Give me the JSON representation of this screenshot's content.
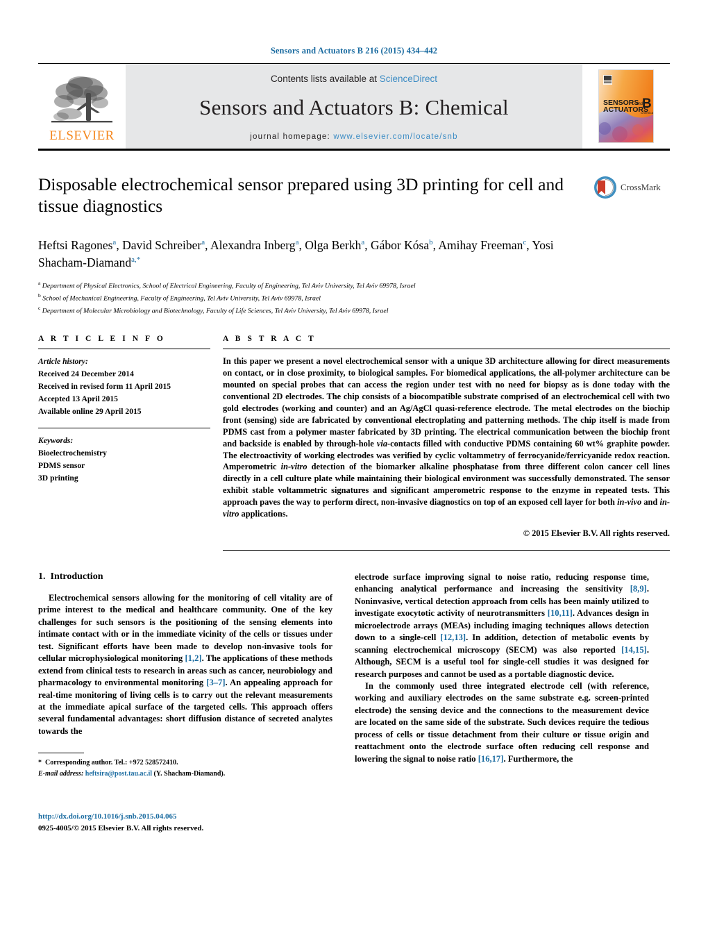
{
  "running_head": "Sensors and Actuators B 216 (2015) 434–442",
  "masthead": {
    "contents_prefix": "Contents lists available at ",
    "sciencedirect": "ScienceDirect",
    "journal_title": "Sensors and Actuators B: Chemical",
    "homepage_prefix": "journal homepage:",
    "homepage_url": "www.elsevier.com/locate/snb",
    "publisher_wordmark": "ELSEVIER",
    "cover": {
      "line1": "SENSORS",
      "and": "and",
      "line2": "ACTUATORS",
      "letter": "B",
      "sub": "Chemical"
    },
    "accent_orange": "#f5881f",
    "accent_blue": "#3c8cc4",
    "panel_gray": "#e6e7e8"
  },
  "title": "Disposable electrochemical sensor prepared using 3D printing for cell and tissue diagnostics",
  "crossmark": {
    "label": "CrossMark"
  },
  "authors_html": "Heftsi Ragones<sup>a</sup>, David Schreiber<sup>a</sup>, Alexandra Inberg<sup>a</sup>, Olga Berkh<sup>a</sup>, Gábor Kósa<sup>b</sup>, Amihay Freeman<sup>c</sup>, Yosi Shacham-Diamand<sup>a,<span class=\"star\">*</span></sup>",
  "affiliations": [
    {
      "mark": "a",
      "text": "Department of Physical Electronics, School of Electrical Engineering, Faculty of Engineering, Tel Aviv University, Tel Aviv 69978, Israel"
    },
    {
      "mark": "b",
      "text": "School of Mechanical Engineering, Faculty of Engineering, Tel Aviv University, Tel Aviv 69978, Israel"
    },
    {
      "mark": "c",
      "text": "Department of Molecular Microbiology and Biotechnology, Faculty of Life Sciences, Tel Aviv University, Tel Aviv 69978, Israel"
    }
  ],
  "article_info": {
    "heading": "A R T I C L E   I N F O",
    "history_label": "Article history:",
    "history": [
      "Received 24 December 2014",
      "Received in revised form 11 April 2015",
      "Accepted 13 April 2015",
      "Available online 29 April 2015"
    ],
    "keywords_label": "Keywords:",
    "keywords": [
      "Bioelectrochemistry",
      "PDMS sensor",
      "3D printing"
    ]
  },
  "abstract": {
    "heading": "A B S T R A C T",
    "body_html": "In this paper we present a novel electrochemical sensor with a unique 3D architecture allowing for direct measurements on contact, or in close proximity, to biological samples. For biomedical applications, the all-polymer architecture can be mounted on special probes that can access the region under test with no need for biopsy as is done today with the conventional 2D electrodes. The chip consists of a biocompatible substrate comprised of an electrochemical cell with two gold electrodes (working and counter) and an Ag/AgCl quasi-reference electrode. The metal electrodes on the biochip front (sensing) side are fabricated by conventional electroplating and patterning methods. The chip itself is made from PDMS cast from a polymer master fabricated by 3D printing. The electrical communication between the biochip front and backside is enabled by through-hole <em>via</em>-contacts filled with conductive PDMS containing 60 wt% graphite powder. The electroactivity of working electrodes was verified by cyclic voltammetry of ferrocyanide/ferricyanide redox reaction. Amperometric <em>in-vitro</em> detection of the biomarker alkaline phosphatase from three different colon cancer cell lines directly in a cell culture plate while maintaining their biological environment was successfully demonstrated. The sensor exhibit stable voltammetric signatures and significant amperometric response to the enzyme in repeated tests. This approach paves the way to perform direct, non-invasive diagnostics on top of an exposed cell layer for both <em>in-vivo</em> and <em>in-vitro</em> applications.",
    "copyright": "© 2015 Elsevier B.V. All rights reserved."
  },
  "introduction": {
    "number": "1.",
    "heading": "Introduction",
    "left_paragraph_html": "Electrochemical sensors allowing for the monitoring of cell vitality are of prime interest to the medical and healthcare community. One of the key challenges for such sensors is the positioning of the sensing elements into intimate contact with or in the immediate vicinity of the cells or tissues under test. Significant efforts have been made to develop non-invasive tools for cellular microphysiological monitoring <span class=\"ref\">[1,2]</span>. The applications of these methods extend from clinical tests to research in areas such as cancer, neurobiology and pharmacology to environmental monitoring <span class=\"ref\">[3–7]</span>. An appealing approach for real-time monitoring of living cells is to carry out the relevant measurements at the immediate apical surface of the targeted cells. This approach offers several fundamental advantages: short diffusion distance of secreted analytes towards the",
    "right_paragraph_1_html": "electrode surface improving signal to noise ratio, reducing response time, enhancing analytical performance and increasing the sensitivity <span class=\"ref\">[8,9]</span>. Noninvasive, vertical detection approach from cells has been mainly utilized to investigate exocytotic activity of neurotransmitters <span class=\"ref\">[10,11]</span>. Advances design in microelectrode arrays (MEAs) including imaging techniques allows detection down to a single-cell <span class=\"ref\">[12,13]</span>. In addition, detection of metabolic events by scanning electrochemical microscopy (SECM) was also reported <span class=\"ref\">[14,15]</span>. Although, SECM is a useful tool for single-cell studies it was designed for research purposes and cannot be used as a portable diagnostic device.",
    "right_paragraph_2_html": "In the commonly used three integrated electrode cell (with reference, working and auxiliary electrodes on the same substrate e.g. screen-printed electrode) the sensing device and the connections to the measurement device are located on the same side of the substrate. Such devices require the tedious process of cells or tissue detachment from their culture or tissue origin and reattachment onto the electrode surface often reducing cell response and lowering the signal to noise ratio <span class=\"ref\">[16,17]</span>. Furthermore, the"
  },
  "footnote": {
    "corresponding_html": "<strong>*</strong>&nbsp; Corresponding author. Tel.: +972 528572410.",
    "email_html": "<em>E-mail address:</em> <span class=\"link\">heftsira@post.tau.ac.il</span> (Y. Shacham-Diamand)."
  },
  "doi": "http://dx.doi.org/10.1016/j.snb.2015.04.065",
  "issn_line": "0925-4005/© 2015 Elsevier B.V. All rights reserved."
}
